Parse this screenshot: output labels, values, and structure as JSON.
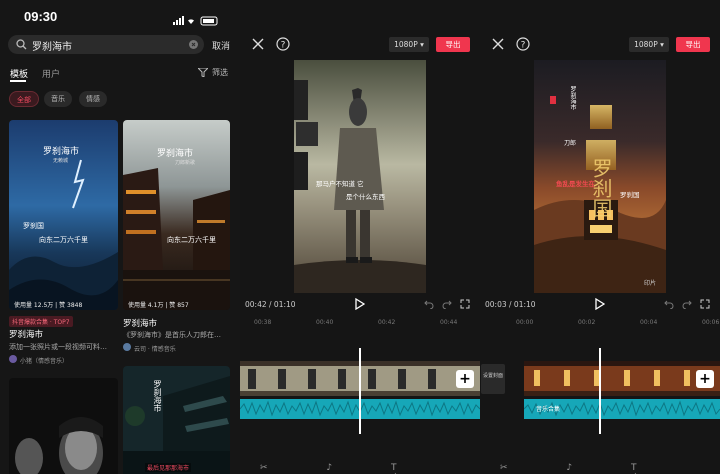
{
  "status_bar": {
    "time": "09:30"
  },
  "search": {
    "query": "罗刹海市",
    "cancel_label": "取消"
  },
  "tabs": [
    {
      "label": "模板"
    },
    {
      "label": "用户"
    }
  ],
  "filter_label": "筛选",
  "chips": [
    {
      "label": "全部"
    },
    {
      "label": "音乐"
    },
    {
      "label": "情感"
    }
  ],
  "cards": [
    {
      "overlay_title": "罗刹海市",
      "overlay_sub": "无赖城",
      "overlay_mid": "罗刹国",
      "overlay_low": "向东二万六千里",
      "stats": "使用量 12.5万 | 赞 3848",
      "badge": "抖音爆款合集 · TOP7",
      "title": "罗刹海市",
      "desc": "添加一张照片或一段视频可料…",
      "user": "小猪（情感音乐）"
    },
    {
      "overlay_title": "罗刹海市",
      "overlay_sub": "刀郎新歌",
      "overlay_low": "向东二万六千里",
      "stats": "使用量 4.1万 | 赞 857",
      "title": "罗刹海市",
      "desc": "《罗刹海市》是首乐人刀郎在…",
      "user": "云司 · 情感音乐"
    },
    {
      "overlay": "罗刹海市"
    },
    {
      "overlay": "最后见那那海市"
    }
  ],
  "editor_left": {
    "resolution": "1080P",
    "export_label": "导出",
    "timecode": "00:42",
    "duration": "01:10",
    "lyric1": "那马户不知道 它",
    "lyric2": "是个什么东西",
    "ruler": [
      "00:38",
      "00:40",
      "00:42",
      "00:44"
    ]
  },
  "editor_right": {
    "resolution": "1080P",
    "export_label": "导出",
    "timecode": "00:03",
    "duration": "01:10",
    "poster_line1": "罗刹海市",
    "poster_line2": "刀郎",
    "poster_big": "罗刹国",
    "poster_lyric_a": "鱼乱是发生在",
    "poster_lyric_b": "罗刹国",
    "watermark": "印片",
    "ruler": [
      "00:00",
      "00:02",
      "00:04",
      "00:06"
    ],
    "track_label": "音乐合集",
    "side_label": "设置封面"
  }
}
